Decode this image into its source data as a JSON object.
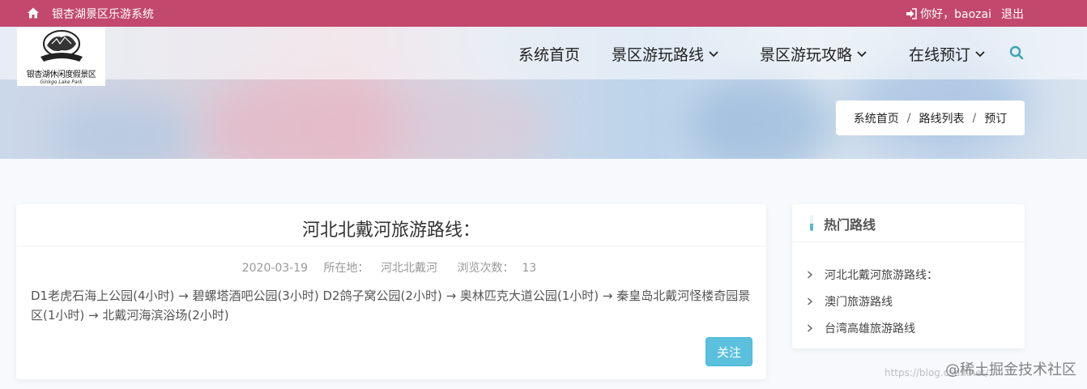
{
  "topbar": {
    "site_title": "银杏湖景区乐游系统",
    "greeting": "你好，baozai",
    "logout": "退出"
  },
  "logo": {
    "text": "银杏湖休闲度假景区",
    "sub": "Ginkgo Lake Park"
  },
  "nav": {
    "items": [
      {
        "label": "系统首页"
      },
      {
        "label": "景区游玩路线"
      },
      {
        "label": "景区游玩攻略"
      },
      {
        "label": "在线预订"
      }
    ]
  },
  "breadcrumb": {
    "items": [
      "系统首页",
      "路线列表",
      "预订"
    ],
    "separator": "/"
  },
  "route": {
    "title": "河北北戴河旅游路线：",
    "date": "2020-03-19",
    "location_label": "所在地：",
    "location": "河北北戴河",
    "views_label": "浏览次数：",
    "views": "13",
    "description": "D1老虎石海上公园(4小时) → 碧螺塔酒吧公园(3小时) D2鸽子窝公园(2小时) → 奥林匹克大道公园(1小时) → 秦皇岛北戴河怪楼奇园景区(1小时) → 北戴河海滨浴场(2小时)",
    "follow_label": "关注"
  },
  "sidebar": {
    "title": "热门路线",
    "items": [
      {
        "label": "河北北戴河旅游路线："
      },
      {
        "label": "澳门旅游路线"
      },
      {
        "label": "台湾高雄旅游路线"
      }
    ]
  },
  "watermark": {
    "text": "@稀土掘金技术社区",
    "url": "https://blog.csdn.net/..."
  },
  "colors": {
    "topbar": "#c2486d",
    "accent": "#3aa5b0",
    "button": "#5bc0de"
  }
}
